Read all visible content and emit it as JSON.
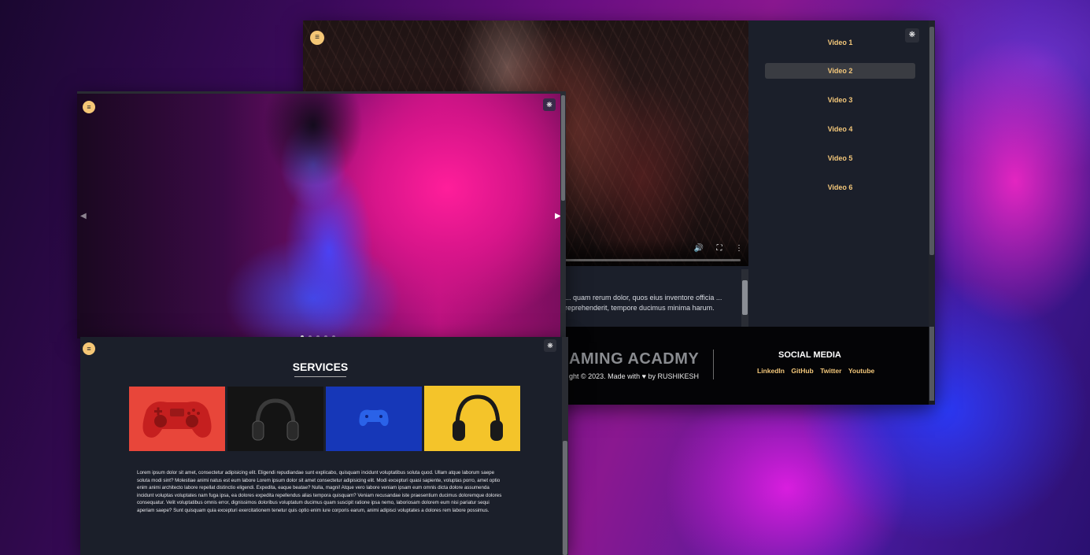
{
  "video_page": {
    "video": {
      "progress_fraction": 0.0,
      "description": "... quam rerum dolor, quos eius inventore officia ... reprehenderit, tempore ducimus minima harum."
    },
    "playlist": [
      {
        "label": "Video 1",
        "active": false
      },
      {
        "label": "Video 2",
        "active": true
      },
      {
        "label": "Video 3",
        "active": false
      },
      {
        "label": "Video 4",
        "active": false
      },
      {
        "label": "Video 5",
        "active": false
      },
      {
        "label": "Video 6",
        "active": false
      }
    ],
    "footer": {
      "brand": "AMING ACADMY",
      "copyright": "ght © 2023. Made with ♥ by RUSHIKESH",
      "social_title": "SOCIAL MEDIA",
      "social_links": [
        "LinkedIn",
        "GitHub",
        "Twitter",
        "Youtube"
      ]
    }
  },
  "hero": {
    "slide_count": 5,
    "active_slide": 1
  },
  "services": {
    "title": "SERVICES",
    "cards": [
      {
        "name": "red-gamepad",
        "bg": "#e8463a"
      },
      {
        "name": "black-headphones",
        "bg": "#141414"
      },
      {
        "name": "blue-gamepad",
        "bg": "#1637b8"
      },
      {
        "name": "yellow-headphones",
        "bg": "#f4c42a"
      }
    ],
    "body": "Lorem ipsum dolor sit amet, consectetur adipisicing elit. Eligendi repudiandae sunt explicabo, quisquam incidunt voluptatibus soluta quod. Ullam atque laborum saepe soluta modi sint? Molestiae animi natus est eum labore Lorem ipsum dolor sit amet consectetur adipisicing elit. Modi excepturi quasi sapiente, voluptas porro, amet optio enim animi architecto labore repellat distinctio eligendi. Expedita, eaque beatae? Nulla, magni! Atque vero labore veniam ipsam eum omnis dicta dolore assumenda incidunt voluptas voluptates nam fuga ipsa, ea dolores expedita repellendus alias tempora quisquam? Veniam recusandae iste praesentium ducimus doloremque dolores consequatur. Velit voluptatibus omnis error, dignissimos doloribus voluptatum ducimus quam suscipit ratione ipsa nemo, laboriosam dolorem eum nisi pariatur sequi aperiam saepe? Sunt quisquam quia excepturi exercitationem tenetur quis optio enim iure corporis earum, animi adipisci voluptates a dolores rem labore possimus."
  },
  "colors": {
    "accent": "#f3c77a",
    "panel": "#1b1f2a",
    "footer": "#040406"
  },
  "icons": {
    "menu": "menu-lines-icon",
    "settings": "gear-icon",
    "volume": "volume-icon",
    "fullscreen": "fullscreen-icon",
    "more": "more-vertical-icon",
    "prev": "chevron-left-icon",
    "next": "chevron-right-icon"
  }
}
